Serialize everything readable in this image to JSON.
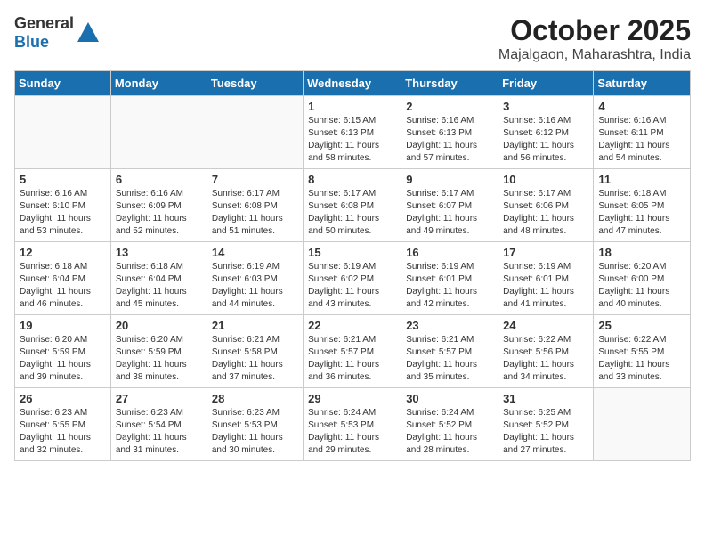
{
  "header": {
    "logo_general": "General",
    "logo_blue": "Blue",
    "month": "October 2025",
    "location": "Majalgaon, Maharashtra, India"
  },
  "days_of_week": [
    "Sunday",
    "Monday",
    "Tuesday",
    "Wednesday",
    "Thursday",
    "Friday",
    "Saturday"
  ],
  "weeks": [
    [
      {
        "day": "",
        "sunrise": "",
        "sunset": "",
        "daylight": ""
      },
      {
        "day": "",
        "sunrise": "",
        "sunset": "",
        "daylight": ""
      },
      {
        "day": "",
        "sunrise": "",
        "sunset": "",
        "daylight": ""
      },
      {
        "day": "1",
        "sunrise": "Sunrise: 6:15 AM",
        "sunset": "Sunset: 6:13 PM",
        "daylight": "Daylight: 11 hours and 58 minutes."
      },
      {
        "day": "2",
        "sunrise": "Sunrise: 6:16 AM",
        "sunset": "Sunset: 6:13 PM",
        "daylight": "Daylight: 11 hours and 57 minutes."
      },
      {
        "day": "3",
        "sunrise": "Sunrise: 6:16 AM",
        "sunset": "Sunset: 6:12 PM",
        "daylight": "Daylight: 11 hours and 56 minutes."
      },
      {
        "day": "4",
        "sunrise": "Sunrise: 6:16 AM",
        "sunset": "Sunset: 6:11 PM",
        "daylight": "Daylight: 11 hours and 54 minutes."
      }
    ],
    [
      {
        "day": "5",
        "sunrise": "Sunrise: 6:16 AM",
        "sunset": "Sunset: 6:10 PM",
        "daylight": "Daylight: 11 hours and 53 minutes."
      },
      {
        "day": "6",
        "sunrise": "Sunrise: 6:16 AM",
        "sunset": "Sunset: 6:09 PM",
        "daylight": "Daylight: 11 hours and 52 minutes."
      },
      {
        "day": "7",
        "sunrise": "Sunrise: 6:17 AM",
        "sunset": "Sunset: 6:08 PM",
        "daylight": "Daylight: 11 hours and 51 minutes."
      },
      {
        "day": "8",
        "sunrise": "Sunrise: 6:17 AM",
        "sunset": "Sunset: 6:08 PM",
        "daylight": "Daylight: 11 hours and 50 minutes."
      },
      {
        "day": "9",
        "sunrise": "Sunrise: 6:17 AM",
        "sunset": "Sunset: 6:07 PM",
        "daylight": "Daylight: 11 hours and 49 minutes."
      },
      {
        "day": "10",
        "sunrise": "Sunrise: 6:17 AM",
        "sunset": "Sunset: 6:06 PM",
        "daylight": "Daylight: 11 hours and 48 minutes."
      },
      {
        "day": "11",
        "sunrise": "Sunrise: 6:18 AM",
        "sunset": "Sunset: 6:05 PM",
        "daylight": "Daylight: 11 hours and 47 minutes."
      }
    ],
    [
      {
        "day": "12",
        "sunrise": "Sunrise: 6:18 AM",
        "sunset": "Sunset: 6:04 PM",
        "daylight": "Daylight: 11 hours and 46 minutes."
      },
      {
        "day": "13",
        "sunrise": "Sunrise: 6:18 AM",
        "sunset": "Sunset: 6:04 PM",
        "daylight": "Daylight: 11 hours and 45 minutes."
      },
      {
        "day": "14",
        "sunrise": "Sunrise: 6:19 AM",
        "sunset": "Sunset: 6:03 PM",
        "daylight": "Daylight: 11 hours and 44 minutes."
      },
      {
        "day": "15",
        "sunrise": "Sunrise: 6:19 AM",
        "sunset": "Sunset: 6:02 PM",
        "daylight": "Daylight: 11 hours and 43 minutes."
      },
      {
        "day": "16",
        "sunrise": "Sunrise: 6:19 AM",
        "sunset": "Sunset: 6:01 PM",
        "daylight": "Daylight: 11 hours and 42 minutes."
      },
      {
        "day": "17",
        "sunrise": "Sunrise: 6:19 AM",
        "sunset": "Sunset: 6:01 PM",
        "daylight": "Daylight: 11 hours and 41 minutes."
      },
      {
        "day": "18",
        "sunrise": "Sunrise: 6:20 AM",
        "sunset": "Sunset: 6:00 PM",
        "daylight": "Daylight: 11 hours and 40 minutes."
      }
    ],
    [
      {
        "day": "19",
        "sunrise": "Sunrise: 6:20 AM",
        "sunset": "Sunset: 5:59 PM",
        "daylight": "Daylight: 11 hours and 39 minutes."
      },
      {
        "day": "20",
        "sunrise": "Sunrise: 6:20 AM",
        "sunset": "Sunset: 5:59 PM",
        "daylight": "Daylight: 11 hours and 38 minutes."
      },
      {
        "day": "21",
        "sunrise": "Sunrise: 6:21 AM",
        "sunset": "Sunset: 5:58 PM",
        "daylight": "Daylight: 11 hours and 37 minutes."
      },
      {
        "day": "22",
        "sunrise": "Sunrise: 6:21 AM",
        "sunset": "Sunset: 5:57 PM",
        "daylight": "Daylight: 11 hours and 36 minutes."
      },
      {
        "day": "23",
        "sunrise": "Sunrise: 6:21 AM",
        "sunset": "Sunset: 5:57 PM",
        "daylight": "Daylight: 11 hours and 35 minutes."
      },
      {
        "day": "24",
        "sunrise": "Sunrise: 6:22 AM",
        "sunset": "Sunset: 5:56 PM",
        "daylight": "Daylight: 11 hours and 34 minutes."
      },
      {
        "day": "25",
        "sunrise": "Sunrise: 6:22 AM",
        "sunset": "Sunset: 5:55 PM",
        "daylight": "Daylight: 11 hours and 33 minutes."
      }
    ],
    [
      {
        "day": "26",
        "sunrise": "Sunrise: 6:23 AM",
        "sunset": "Sunset: 5:55 PM",
        "daylight": "Daylight: 11 hours and 32 minutes."
      },
      {
        "day": "27",
        "sunrise": "Sunrise: 6:23 AM",
        "sunset": "Sunset: 5:54 PM",
        "daylight": "Daylight: 11 hours and 31 minutes."
      },
      {
        "day": "28",
        "sunrise": "Sunrise: 6:23 AM",
        "sunset": "Sunset: 5:53 PM",
        "daylight": "Daylight: 11 hours and 30 minutes."
      },
      {
        "day": "29",
        "sunrise": "Sunrise: 6:24 AM",
        "sunset": "Sunset: 5:53 PM",
        "daylight": "Daylight: 11 hours and 29 minutes."
      },
      {
        "day": "30",
        "sunrise": "Sunrise: 6:24 AM",
        "sunset": "Sunset: 5:52 PM",
        "daylight": "Daylight: 11 hours and 28 minutes."
      },
      {
        "day": "31",
        "sunrise": "Sunrise: 6:25 AM",
        "sunset": "Sunset: 5:52 PM",
        "daylight": "Daylight: 11 hours and 27 minutes."
      },
      {
        "day": "",
        "sunrise": "",
        "sunset": "",
        "daylight": ""
      }
    ]
  ]
}
